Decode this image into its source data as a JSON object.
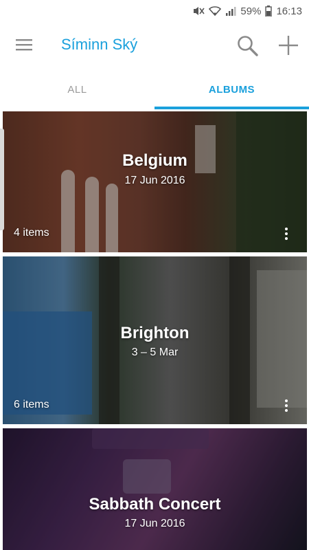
{
  "status_bar": {
    "mute_icon": "mute-icon",
    "wifi_icon": "wifi-icon",
    "signal_icon": "signal-icon",
    "battery_percent": "59%",
    "battery_icon": "battery-icon",
    "time": "16:13"
  },
  "app_bar": {
    "menu_icon": "menu-icon",
    "title": "Síminn Ský",
    "search_icon": "search-icon",
    "add_icon": "add-icon"
  },
  "tabs": [
    {
      "label": "ALL",
      "selected": false
    },
    {
      "label": "ALBUMS",
      "selected": true
    }
  ],
  "colors": {
    "accent": "#1aa0dc",
    "inactive_tab": "#9a9a9a"
  },
  "albums": [
    {
      "title": "Belgium",
      "date": "17 Jun 2016",
      "count": "4 items",
      "more_icon": "more-vert-icon"
    },
    {
      "title": "Brighton",
      "date": "3 – 5 Mar",
      "count": "6 items",
      "more_icon": "more-vert-icon"
    },
    {
      "title": "Sabbath Concert",
      "date": "17 Jun 2016"
    }
  ]
}
